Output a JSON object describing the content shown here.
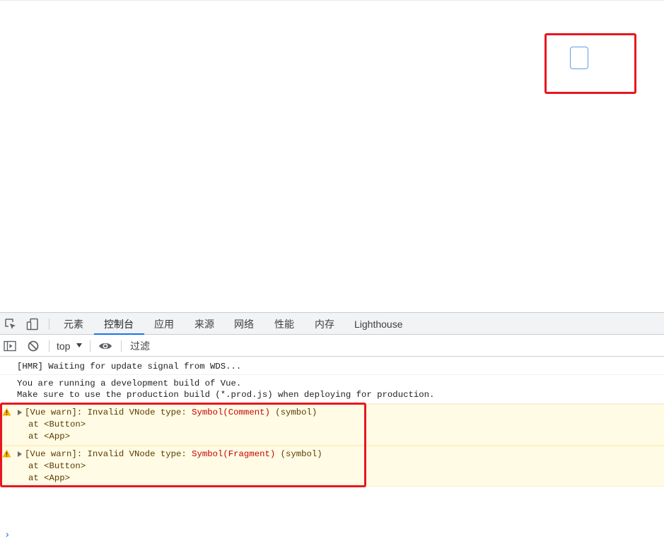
{
  "devtools": {
    "tabs": [
      {
        "label": "元素"
      },
      {
        "label": "控制台"
      },
      {
        "label": "应用"
      },
      {
        "label": "来源"
      },
      {
        "label": "网络"
      },
      {
        "label": "性能"
      },
      {
        "label": "内存"
      },
      {
        "label": "Lighthouse"
      }
    ],
    "active_tab": "控制台",
    "accent_color": "#1a73e8",
    "toolbar": {
      "context": "top",
      "filter_placeholder": "过滤"
    }
  },
  "console": {
    "messages": [
      {
        "type": "log",
        "lines": [
          "[HMR] Waiting for update signal from WDS..."
        ]
      },
      {
        "type": "log",
        "lines": [
          "You are running a development build of Vue.",
          "Make sure to use the production build (*.prod.js) when deploying for production."
        ]
      },
      {
        "type": "warning",
        "prefix": "[Vue warn]: Invalid VNode type: ",
        "symbol": "Symbol(Comment)",
        "suffix": " (symbol)",
        "stack": [
          "at <Button>",
          "at <App>"
        ]
      },
      {
        "type": "warning",
        "prefix": "[Vue warn]: Invalid VNode type: ",
        "symbol": "Symbol(Fragment)",
        "suffix": " (symbol)",
        "stack": [
          "at <Button>",
          "at <App>"
        ]
      }
    ],
    "prompt": "›"
  },
  "annotation_color": "#e8161f"
}
